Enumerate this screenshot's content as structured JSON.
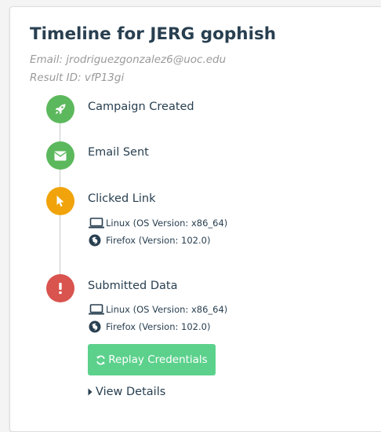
{
  "timeline": {
    "title": "Timeline for JERG gophish",
    "email": "Email: jrodriguezgonzalez6@uoc.edu",
    "result_id": "Result ID: vfP13gi"
  },
  "events": [
    {
      "label": "Campaign Created",
      "icon": "rocket-icon",
      "color": "#5cb85c"
    },
    {
      "label": "Email Sent",
      "icon": "envelope-icon",
      "color": "#5cb85c"
    },
    {
      "label": "Clicked Link",
      "icon": "pointer-icon",
      "color": "#f0a30a",
      "os": "Linux (OS Version: x86_64)",
      "browser": "Firefox (Version: 102.0)"
    },
    {
      "label": "Submitted Data",
      "icon": "exclamation-icon",
      "color": "#d9534f",
      "os": "Linux (OS Version: x86_64)",
      "browser": "Firefox (Version: 102.0)"
    }
  ],
  "actions": {
    "replay_label": "Replay Credentials",
    "view_details_label": "View Details"
  }
}
